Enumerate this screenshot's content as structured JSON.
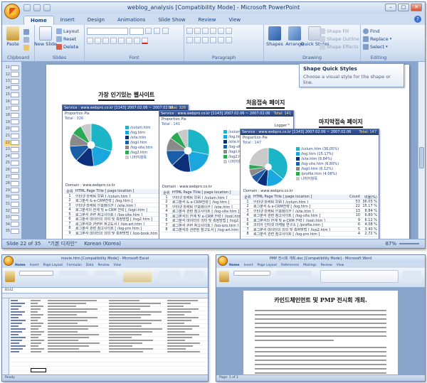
{
  "ppt": {
    "window_title": "weblog_analysis [Compatibility Mode] - Microsoft PowerPoint",
    "tabs": [
      "Home",
      "Insert",
      "Design",
      "Animations",
      "Slide Show",
      "Review",
      "View"
    ],
    "ribbon": {
      "clipboard": {
        "label": "Clipboard",
        "paste": "Paste"
      },
      "slides": {
        "label": "Slides",
        "new_slide": "New Slide",
        "layout": "Layout",
        "reset": "Reset",
        "delete": "Delete"
      },
      "font_label": "Font",
      "paragraph_label": "Paragraph",
      "drawing": {
        "label": "Drawing",
        "shapes": "Shapes",
        "arrange": "Arrange",
        "quick_styles": "Quick Styles",
        "shape_fill": "Shape Fill",
        "shape_outline": "Shape Outline",
        "shape_effects": "Shape Effects"
      },
      "editing": {
        "label": "Editing",
        "find": "Find",
        "replace": "Replace",
        "select": "Select"
      }
    },
    "tooltip": {
      "title": "Shape Quick Styles",
      "body": "Choose a visual style for the shape or line."
    },
    "thumbnails": [
      "11",
      "12",
      "13",
      "14",
      "15",
      "16",
      "17",
      "18",
      "19",
      "20",
      "21",
      "22",
      "23",
      "24",
      "25",
      "26",
      "27",
      "28",
      "29",
      "30",
      "31",
      "32",
      "33",
      "34",
      "35"
    ],
    "selected_thumbnail": "22",
    "status": {
      "slide": "Slide 22 of 35",
      "theme": "\"기본 디자인\"",
      "language": "Korean (Korea)",
      "zoom": "87%"
    },
    "slide": {
      "headings": [
        "가장 인기있는 웹사이트",
        "처음접속 페이지",
        "마지막접속 페이지"
      ],
      "shots": [
        {
          "service": "Service : www.webpro.co.kr [1143]  2007.02.06 ~ 2007.02.06",
          "total": "Total: 326",
          "proportion": "Proportion Pie",
          "total_small": "Total : 326",
          "legend": [
            "/colum.htm",
            "/log.htm",
            "/site.htm",
            "/logil.htm",
            "/log-site.htm",
            "/log2.htm",
            "나머지항목"
          ],
          "domain": "Domain : www.webpro.co.kr",
          "table_head": [
            "순위",
            "HTML Page Title [ page location ]"
          ],
          "rows": [
            [
              "1",
              "인터넷 마케팅 칼럼 [ /colum.htm ]"
            ],
            [
              "2",
              "로그분석 & e-CRM전략 [ /log.htm ]"
            ],
            [
              "3",
              "인터넷 마케팅 인포메이션 [ /site.htm ]"
            ],
            [
              "4",
              "로그분석의 한계 및 e-CRM 전략 [ /logil.htm ]"
            ],
            [
              "5",
              "로그분석 관련 참고사이트 [ /log-site.htm ]"
            ],
            [
              "6",
              "로그분석 데이터의 의미 및 측정방법 [ /log2.htm ]"
            ],
            [
              "7",
              "로그분석과 관련된 참고도서 [ /log-art.htm ]"
            ],
            [
              "8",
              "로그분석 관련 참고사이트 [ /log-pro.htm ]"
            ],
            [
              "9",
              "로그분석 데이터의 의미 및 측정방법 [ /log-book.htm ]"
            ]
          ]
        },
        {
          "service": "Service : www.webpro.co.kr [1143]  2007.02.06 ~ 2007.02.06",
          "total": "Total: 141",
          "proportion": "Proportion Pie",
          "total_small": "Total : 141",
          "legend": [
            "/colum.htm",
            "/log.htm",
            "/site.htm",
            "/log-site.htm",
            "/logil.htm",
            "/log2.htm",
            "나머지항목"
          ],
          "domain": "Domain : www.webpro.co.kr",
          "table_head": [
            "순위",
            "HTML Page Title [ page location ]"
          ],
          "rows": [
            [
              "1",
              "인터넷 마케팅 칼럼 [ /colum.htm ]"
            ],
            [
              "2",
              "로그분석 & e-CRM전략 [ /log.htm ]"
            ],
            [
              "3",
              "인터넷 마케팅 인포메이션 [ /site.htm ]"
            ],
            [
              "4",
              "로그분석 관련 참고사이트 [ /log-site.htm ]"
            ],
            [
              "5",
              "로그분석의 한계 및 e-CRM 전략 [ /logil.htm ]"
            ],
            [
              "6",
              "로그분석 데이터의 의미 및 측정방법 [ /log2.htm ]"
            ],
            [
              "7",
              "로그분석 관련 참고사이트 [ /log-pro.htm ]"
            ],
            [
              "8",
              "로그분석과 관련된 참고도서 [ /log-art.htm ]"
            ]
          ]
        },
        {
          "service": "Service : www.webpro.co.kr [1143]  2007.02.06 ~ 2007.02.06",
          "total": "Total: 147",
          "proportion": "Proportion Pie",
          "total_small": "Total : 147",
          "legend": [
            "/colum.htm (36.05%)",
            "/log.htm (15.17%)",
            "/site.htm (8.84%)",
            "/log-site.htm (6.80%)",
            "/logil.htm (6.12%)",
            "/profile.htm (4.08%)",
            "나머지항목"
          ],
          "domain": "Domain : www.webpro.co.kr",
          "table_head": [
            "순위",
            "HTML Page Title [ page location ]",
            "Count",
            "비율(%)"
          ],
          "rows": [
            [
              "1",
              "인터넷 마케팅 칼럼 [ /colum.htm ]",
              "53",
              "36.05 %"
            ],
            [
              "2",
              "로그분석 & e-CRM전략 [ /log.htm ]",
              "22",
              "15.17 %"
            ],
            [
              "3",
              "인터넷 마케팅 인포메이션 [ /site.htm ]",
              "13",
              "8.84 %"
            ],
            [
              "4",
              "로그분석 관련 참고사이트 [ /log-site.htm ]",
              "10",
              "6.80 %"
            ],
            [
              "5",
              "로그분석의 한계 및 e-CRM 전략 [ /logil.htm ]",
              "9",
              "6.12 %"
            ],
            [
              "6",
              "코리아 인터넷 마케팅 연구소 [ /profile.htm ]",
              "6",
              "4.08 %"
            ],
            [
              "7",
              "로그분석 데이터의 의미 및 측정방법 [ /log2.htm ]",
              "5",
              "3.40 %"
            ],
            [
              "8",
              "로그분석 관련 참고사이트 [ /log-pro.htm ]",
              "4",
              "2.72 %"
            ]
          ]
        }
      ]
    }
  },
  "excel": {
    "window_title": "movie.htm [Compatibility Mode] - Microsoft Excel",
    "tabs": [
      "Home",
      "Insert",
      "Page Layout",
      "Formulas",
      "Data",
      "Review",
      "View"
    ],
    "name_box": "B142",
    "status": "Ready"
  },
  "word": {
    "window_title": "PMP 전시회 개최.doc [Compatibility Mode] - Microsoft Word",
    "tabs": [
      "Home",
      "Insert",
      "Page Layout",
      "References",
      "Mailings",
      "Review",
      "View"
    ],
    "doc_title": "카인드체인먼트 및 PMP 전시회 개최.",
    "status": "Page: 1 of 1"
  },
  "colors": {
    "pie": [
      "#1bb5c7",
      "#1aa7e0",
      "#0b2f7a",
      "#1b5ea8",
      "#8a8a8a",
      "#2aa854",
      "#c9c9c9"
    ]
  }
}
